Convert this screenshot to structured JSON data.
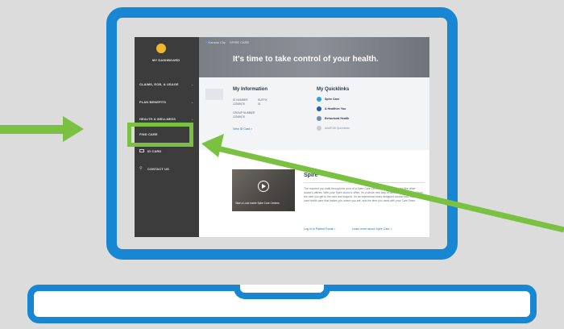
{
  "colors": {
    "laptop": "#1787d3",
    "highlight": "#7ac142",
    "sidebar": "#3c3c3c"
  },
  "topbar": {
    "location": "Kansas City",
    "brand": "SPIRE CARE"
  },
  "sidebar": {
    "dashboard_label": "MY DASHBOARD",
    "items": [
      {
        "label": "CLAIMS, EOB, & USAGE"
      },
      {
        "label": "PLAN BENEFITS"
      },
      {
        "label": "HEALTH & WELLNESS"
      },
      {
        "label": "FIND CARE"
      },
      {
        "label": "ID CARD"
      },
      {
        "label": "CONTACT US"
      }
    ]
  },
  "hero": {
    "title": "It's time to take control of your health."
  },
  "my_info": {
    "title": "My Information",
    "id_number_label": "ID NUMBER",
    "id_number": "12345678",
    "suffix_label": "SUFFIX",
    "suffix": "01",
    "group_label": "GROUP NUMBER",
    "group": "12345678",
    "view_card": "View ID Card  >"
  },
  "quicklinks": {
    "title": "My Quicklinks",
    "items": [
      {
        "label": "Spire Care",
        "color": "#29a3d9"
      },
      {
        "label": "A Healthier You",
        "color": "#1f5ea8"
      },
      {
        "label": "Behavioral Health",
        "color": "#6c8fb0"
      },
      {
        "label": "Add/Edit Quicklinks",
        "color": "#c7ccd1"
      }
    ]
  },
  "video": {
    "caption": "Take a Look Inside Spire Care Centers"
  },
  "spire": {
    "heading": "Spire",
    "paragraph": "The moment you walk through the door of a Spire Care Center, you'll notice it's not like other doctor's offices. With your Spire doctor's office, it's a whole new way of delivering healthcare. From the care you get to the care and support, it's an experience that's designed around you. Have your care health care that makes you where you are, and the time you need with your Care Team.",
    "patient_portal": "Log in to Patient Portal  >",
    "learn_more": "Learn more about Spire Care  >"
  }
}
